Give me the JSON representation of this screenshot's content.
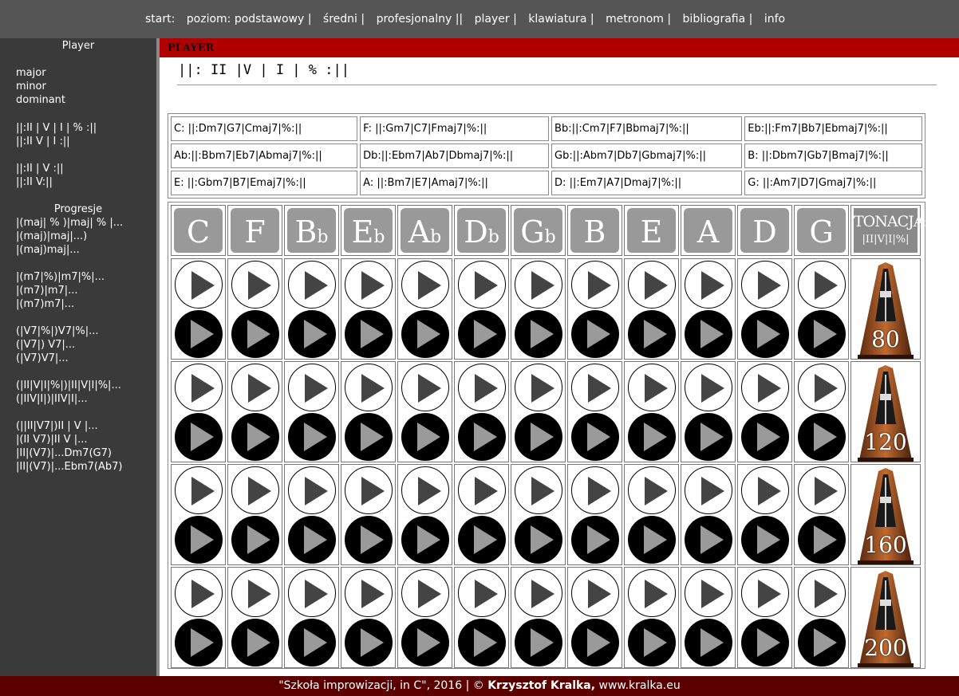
{
  "nav": {
    "start": "start:",
    "items": [
      {
        "label": "poziom: podstawowy",
        "sep": "|"
      },
      {
        "label": "średni",
        "sep": "|"
      },
      {
        "label": "profesjonalny",
        "sep": "||"
      },
      {
        "label": "player",
        "sep": "|"
      },
      {
        "label": "klawiatura",
        "sep": "|"
      },
      {
        "label": "metronom",
        "sep": "|"
      },
      {
        "label": "bibliografia",
        "sep": "|"
      },
      {
        "label": "info",
        "sep": ""
      }
    ]
  },
  "sidebar": {
    "title": "Player",
    "modes": [
      "major",
      "minor",
      "dominant"
    ],
    "forms1": [
      "||:II | V | I | % :||",
      "||:II V | I :||"
    ],
    "forms2": [
      "||:II | V :||",
      "||:II V:||"
    ],
    "progresje_title": "Progresje",
    "prog1": [
      "|(maj| % )|maj| % |...",
      "|(maj)|maj|...)",
      "|(maj)maj|..."
    ],
    "prog2": [
      "|(m7|%)|m7|%|...",
      "|(m7)|m7|...",
      "|(m7)m7|..."
    ],
    "prog3": [
      "(|V7|%|)V7|%|...",
      "(|V7|) V7|...",
      "(|V7)V7|..."
    ],
    "prog4": [
      "(|II|V|I|%|)|II|V|I|%|...",
      "(|IIV|I|)|IIV|I|..."
    ],
    "prog5": [
      "(||II|V7|)II | V |...",
      "|(II V7)|II V |...",
      "|II|(V7)|...Dm7(G7)",
      "|II|(V7)|...Ebm7(Ab7)"
    ]
  },
  "main": {
    "header": "PLAYER",
    "progression": "||: II |V | I | % :||",
    "keys_table": [
      [
        "C: ||:Dm7|G7|Cmaj7|%:||",
        "F: ||:Gm7|C7|Fmaj7|%:||",
        "Bb:||:Cm7|F7|Bbmaj7|%:||",
        "Eb:||:Fm7|Bb7|Ebmaj7|%:||"
      ],
      [
        "Ab:||:Bbm7|Eb7|Abmaj7|%:||",
        "Db:||:Ebm7|Ab7|Dbmaj7|%:||",
        "Gb:||:Abm7|Db7|Gbmaj7|%:||",
        "B: ||:Dbm7|Gb7|Bmaj7|%:||"
      ],
      [
        "E: ||:Gbm7|B7|Emaj7|%:||",
        "A: ||:Bm7|E7|Amaj7|%:||",
        "D: ||:Em7|A7|Dmaj7|%:||",
        "G: ||:Am7|D7|Gmaj7|%:||"
      ]
    ],
    "key_buttons": [
      {
        "root": "C",
        "acc": ""
      },
      {
        "root": "F",
        "acc": ""
      },
      {
        "root": "B",
        "acc": "b"
      },
      {
        "root": "E",
        "acc": "b"
      },
      {
        "root": "A",
        "acc": "b"
      },
      {
        "root": "D",
        "acc": "b"
      },
      {
        "root": "G",
        "acc": "b"
      },
      {
        "root": "B",
        "acc": ""
      },
      {
        "root": "E",
        "acc": ""
      },
      {
        "root": "A",
        "acc": ""
      },
      {
        "root": "D",
        "acc": ""
      },
      {
        "root": "G",
        "acc": ""
      }
    ],
    "tonacja": {
      "title": "TONACJA:",
      "sub": "|II|V|I|%|"
    },
    "tempos": [
      "80",
      "120",
      "160",
      "200"
    ],
    "icons": {
      "play_white": "play-icon",
      "play_black": "play-icon",
      "metronome": "metronome-icon"
    }
  },
  "footer": {
    "text": "\"Szkoła improwizacji, in C\", 2016 | ©",
    "author": "Krzysztof Kralka,",
    "site": "www.kralka.eu"
  }
}
